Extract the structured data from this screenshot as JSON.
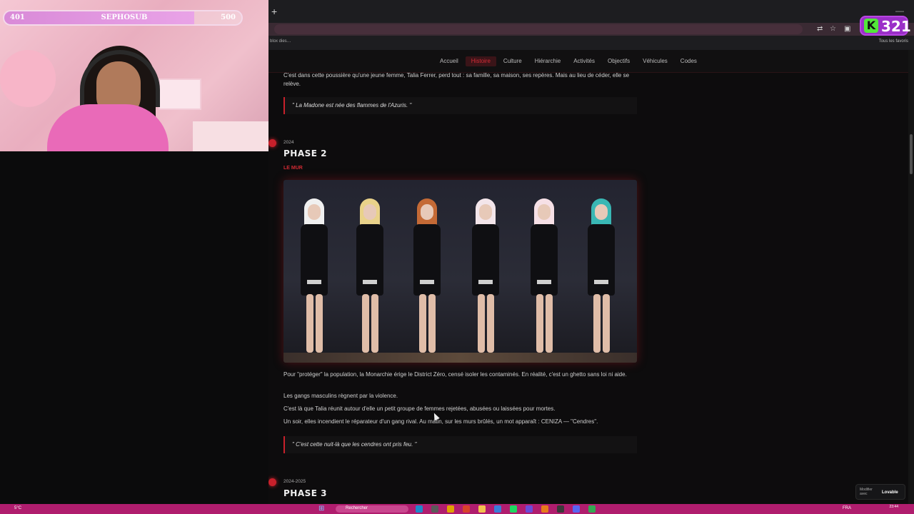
{
  "browser": {
    "bookmark_left": "blox dies…",
    "bookmark_right": "Tous les favoris"
  },
  "site": {
    "nav": [
      "Accueil",
      "Histoire",
      "Culture",
      "Hiérarchie",
      "Activités",
      "Objectifs",
      "Véhicules",
      "Codes"
    ],
    "active_nav": "Histoire",
    "intro_text": "C'est dans cette poussière qu'une jeune femme, Talia Ferrer, perd tout : sa famille, sa maison, ses repères. Mais au lieu de céder, elle se relève.",
    "quote1": "\" La Madone est née des flammes de l'Azuris. \"",
    "phase2": {
      "date": "2024",
      "title": "PHASE 2",
      "subtitle": "LE MUR",
      "paragraphs": [
        "Pour \"protéger\" la population, la Monarchie érige le District Zéro, censé isoler les contaminés. En réalité, c'est un ghetto sans loi ni aide.",
        "Les gangs masculins règnent par la violence.",
        "C'est là que Talia réunit autour d'elle un petit groupe de femmes rejetées, abusées ou laissées pour mortes.",
        "Un soir, elles incendient le réparateur d'un gang rival. Au matin, sur les murs brûlés, un mot apparaît : CENIZA — \"Cendres\"."
      ],
      "quote": "\" C'est cette nuit-là que les cendres ont pris feu. \""
    },
    "phase3": {
      "date": "2024-2025",
      "title": "PHASE 3"
    }
  },
  "overlay": {
    "hp_low": "401",
    "hp_name": "SEPHOSUB",
    "hp_high": "500",
    "hp_fill_fraction": 0.8,
    "k_badge_letter": "K",
    "k_badge_number": "321",
    "lovable_line1": "Modifier",
    "lovable_line2": "avec",
    "lovable_brand": "Lovable"
  },
  "taskbar": {
    "weather": "5°C",
    "search": "Rechercher",
    "lang": "FRA",
    "time": "23:44",
    "date": ""
  },
  "colors": {
    "accent": "#c8202b",
    "taskbar": "#b01d6e",
    "badge": "#9b2fc8"
  }
}
